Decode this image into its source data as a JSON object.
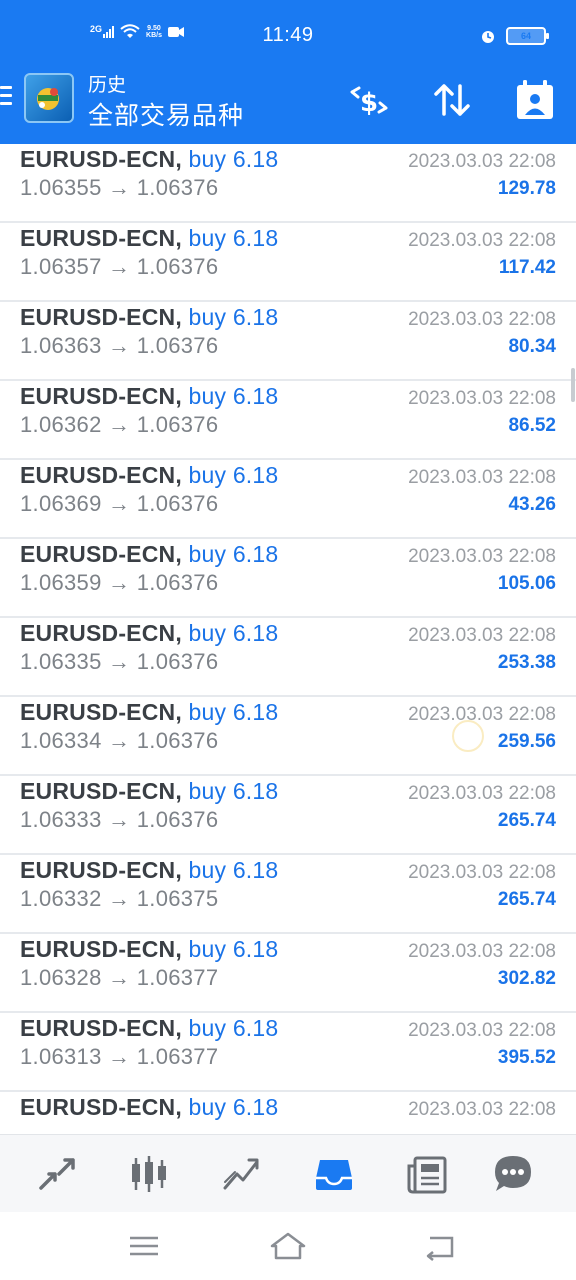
{
  "status_bar": {
    "network": "2G",
    "speed_value": "9.50",
    "speed_unit": "KB/s",
    "time": "11:49",
    "battery_level": "64"
  },
  "header": {
    "subtitle": "历史",
    "title": "全部交易品种",
    "icons": [
      "dollar-cycle-icon",
      "sort-icon",
      "calendar-icon"
    ]
  },
  "trades": [
    {
      "symbol": "EURUSD-ECN,",
      "type": "buy",
      "volume": "6.18",
      "open": "1.06355",
      "close": "1.06376",
      "time": "2023.03.03 22:08",
      "profit": "129.78"
    },
    {
      "symbol": "EURUSD-ECN,",
      "type": "buy",
      "volume": "6.18",
      "open": "1.06357",
      "close": "1.06376",
      "time": "2023.03.03 22:08",
      "profit": "117.42"
    },
    {
      "symbol": "EURUSD-ECN,",
      "type": "buy",
      "volume": "6.18",
      "open": "1.06363",
      "close": "1.06376",
      "time": "2023.03.03 22:08",
      "profit": "80.34"
    },
    {
      "symbol": "EURUSD-ECN,",
      "type": "buy",
      "volume": "6.18",
      "open": "1.06362",
      "close": "1.06376",
      "time": "2023.03.03 22:08",
      "profit": "86.52"
    },
    {
      "symbol": "EURUSD-ECN,",
      "type": "buy",
      "volume": "6.18",
      "open": "1.06369",
      "close": "1.06376",
      "time": "2023.03.03 22:08",
      "profit": "43.26"
    },
    {
      "symbol": "EURUSD-ECN,",
      "type": "buy",
      "volume": "6.18",
      "open": "1.06359",
      "close": "1.06376",
      "time": "2023.03.03 22:08",
      "profit": "105.06"
    },
    {
      "symbol": "EURUSD-ECN,",
      "type": "buy",
      "volume": "6.18",
      "open": "1.06335",
      "close": "1.06376",
      "time": "2023.03.03 22:08",
      "profit": "253.38"
    },
    {
      "symbol": "EURUSD-ECN,",
      "type": "buy",
      "volume": "6.18",
      "open": "1.06334",
      "close": "1.06376",
      "time": "2023.03.03 22:08",
      "profit": "259.56"
    },
    {
      "symbol": "EURUSD-ECN,",
      "type": "buy",
      "volume": "6.18",
      "open": "1.06333",
      "close": "1.06376",
      "time": "2023.03.03 22:08",
      "profit": "265.74"
    },
    {
      "symbol": "EURUSD-ECN,",
      "type": "buy",
      "volume": "6.18",
      "open": "1.06332",
      "close": "1.06375",
      "time": "2023.03.03 22:08",
      "profit": "265.74"
    },
    {
      "symbol": "EURUSD-ECN,",
      "type": "buy",
      "volume": "6.18",
      "open": "1.06328",
      "close": "1.06377",
      "time": "2023.03.03 22:08",
      "profit": "302.82"
    },
    {
      "symbol": "EURUSD-ECN,",
      "type": "buy",
      "volume": "6.18",
      "open": "1.06313",
      "close": "1.06377",
      "time": "2023.03.03 22:08",
      "profit": "395.52"
    },
    {
      "symbol": "EURUSD-ECN,",
      "type": "buy",
      "volume": "6.18",
      "open": "",
      "close": "",
      "time": "2023.03.03 22:08",
      "profit": ""
    }
  ],
  "bottom_nav": {
    "items": [
      "quotes-icon",
      "chart-icon",
      "trade-icon",
      "history-icon",
      "news-icon",
      "chat-icon"
    ],
    "active": "history-icon"
  },
  "system_nav": [
    "menu-icon",
    "home-icon",
    "back-icon"
  ],
  "colors": {
    "accent": "#1a7af2",
    "profit": "#1a73e8",
    "symbol": "#3a3f45",
    "muted": "#9a9ea3"
  }
}
